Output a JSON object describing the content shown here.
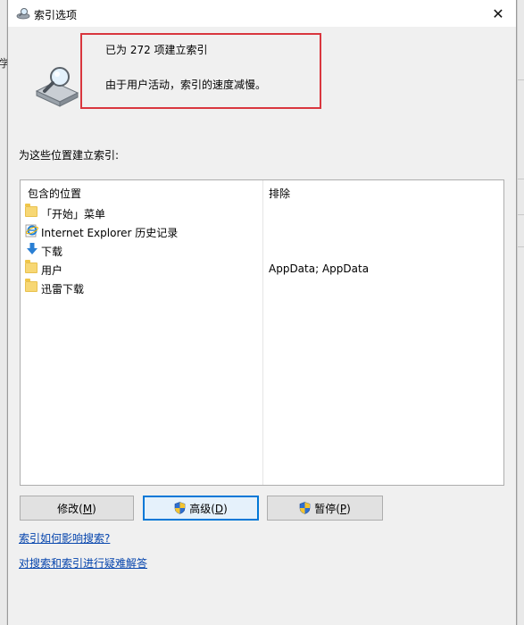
{
  "window": {
    "title": "索引选项",
    "close_glyph": "✕"
  },
  "background": {
    "left_fragment": "学"
  },
  "status": {
    "line1": "已为 272 项建立索引",
    "line2": "由于用户活动，索引的速度减慢。"
  },
  "locations_label": "为这些位置建立索引:",
  "table": {
    "columns": [
      "包含的位置",
      "排除"
    ],
    "rows": [
      {
        "name": "「开始」菜单",
        "exclude": "",
        "icon": "folder-icon"
      },
      {
        "name": "Internet Explorer 历史记录",
        "exclude": "",
        "icon": "ie-icon"
      },
      {
        "name": "下载",
        "exclude": "",
        "icon": "download-icon"
      },
      {
        "name": "用户",
        "exclude": "AppData; AppData",
        "icon": "folder-icon"
      },
      {
        "name": "迅雷下载",
        "exclude": "",
        "icon": "folder-icon"
      }
    ]
  },
  "buttons": {
    "modify": {
      "label": "修改(",
      "key": "M",
      "close": ")"
    },
    "advanced": {
      "label": "高级(",
      "key": "D",
      "close": ")"
    },
    "pause": {
      "label": "暂停(",
      "key": "P",
      "close": ")"
    }
  },
  "links": {
    "how_affects": "索引如何影响搜索?",
    "troubleshoot": "对搜索和索引进行疑难解答"
  },
  "colors": {
    "highlight_border": "#d9363e",
    "link": "#0645ad",
    "default_button_border": "#0078d7"
  }
}
